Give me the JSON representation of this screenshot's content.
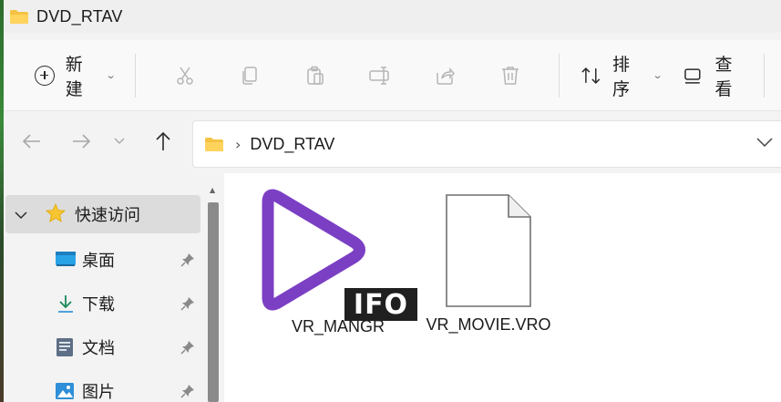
{
  "window": {
    "title": "DVD_RTAV"
  },
  "toolbar": {
    "new_label": "新建",
    "sort_label": "排序",
    "view_label": "查看",
    "icons": [
      "cut-icon",
      "copy-icon",
      "paste-icon",
      "rename-icon",
      "share-icon",
      "delete-icon"
    ]
  },
  "address": {
    "path": [
      "DVD_RTAV"
    ]
  },
  "sidebar": {
    "quick_access_label": "快速访问",
    "items": [
      {
        "label": "桌面",
        "icon": "desktop-icon",
        "pinned": true
      },
      {
        "label": "下载",
        "icon": "download-icon",
        "pinned": true
      },
      {
        "label": "文档",
        "icon": "document-icon",
        "pinned": true
      },
      {
        "label": "图片",
        "icon": "pictures-icon",
        "pinned": true
      }
    ]
  },
  "files": [
    {
      "name": "VR_MANGR",
      "type": "IFO",
      "badge": "IFO",
      "icon": "media-play-icon"
    },
    {
      "name": "VR_MOVIE.VRO",
      "type": "VRO",
      "icon": "blank-file-icon"
    }
  ],
  "colors": {
    "accent": "#7b3fc4",
    "folder": "#f5c342",
    "selection": "#dcdcdc"
  }
}
